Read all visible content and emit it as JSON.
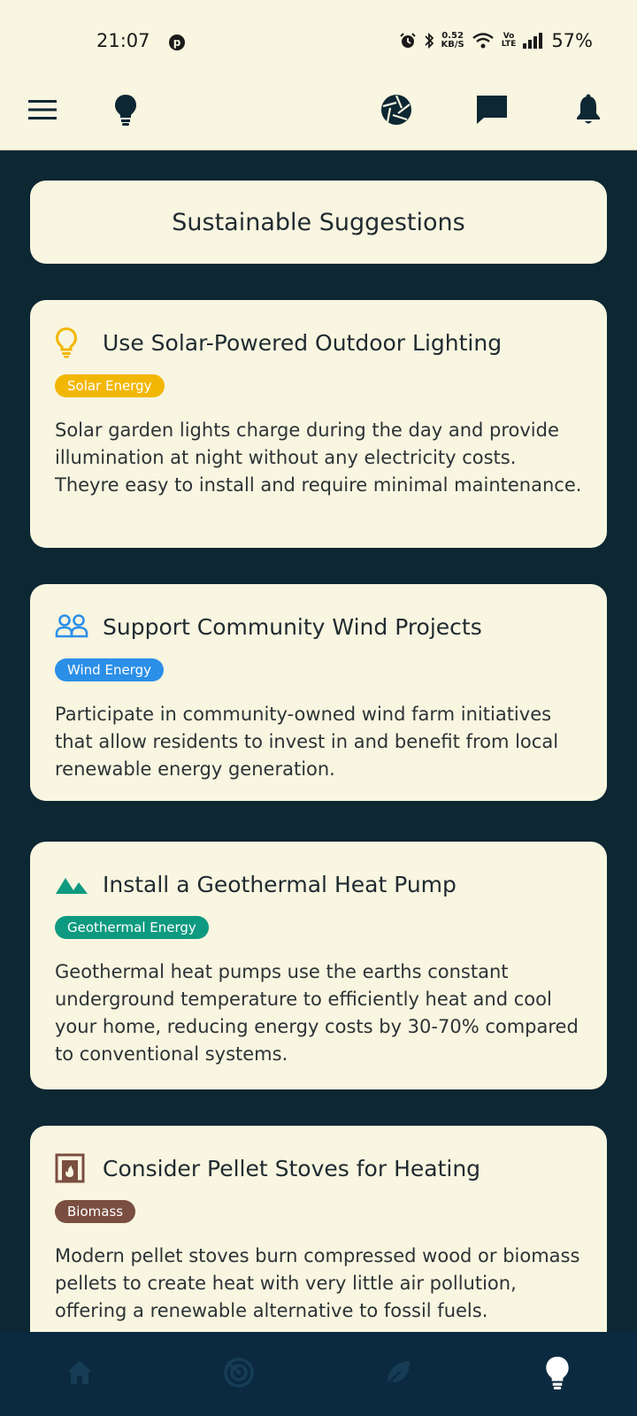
{
  "status_bar": {
    "time": "21:07",
    "net_speed_value": "0.52",
    "net_speed_unit": "KB/S",
    "volte_top": "Vo",
    "volte_bottom": "LTE",
    "battery": "57%"
  },
  "app_bar": {
    "icons": [
      "menu-icon",
      "lightbulb-icon",
      "camera-aperture-icon",
      "chat-icon",
      "bell-icon"
    ]
  },
  "page": {
    "title": "Sustainable Suggestions"
  },
  "cards": [
    {
      "icon": "lightbulb-outline-icon",
      "title": "Use Solar-Powered Outdoor Lighting",
      "tag": "Solar Energy",
      "tag_color": "#f2b705",
      "text": "Solar garden lights charge during the day and provide illumination at night without any electricity costs. Theyre easy to install and require minimal maintenance."
    },
    {
      "icon": "people-icon",
      "title": "Support Community Wind Projects",
      "tag": "Wind Energy",
      "tag_color": "#2b8fe8",
      "text": "Participate in community-owned wind farm initiatives that allow residents to invest in and benefit from local renewable energy generation."
    },
    {
      "icon": "mountain-icon",
      "title": "Install a Geothermal Heat Pump",
      "tag": "Geothermal Energy",
      "tag_color": "#0e9a80",
      "text": "Geothermal heat pumps use the earths constant underground temperature to efficiently heat and cool your home, reducing energy costs by 30-70% compared to conventional systems."
    },
    {
      "icon": "fireplace-icon",
      "title": "Consider Pellet Stoves for Heating",
      "tag": "Biomass",
      "tag_color": "#7a4e40",
      "text": "Modern pellet stoves burn compressed wood or biomass pellets to create heat with very little air pollution, offering a renewable alternative to fossil fuels."
    }
  ],
  "bottom_nav": {
    "items": [
      "home-icon",
      "radar-icon",
      "leaf-icon",
      "lightbulb-icon"
    ],
    "active_index": 3
  },
  "colors": {
    "background": "#0d2733",
    "card": "#f8f5e0",
    "nav": "#0b2a3f"
  }
}
